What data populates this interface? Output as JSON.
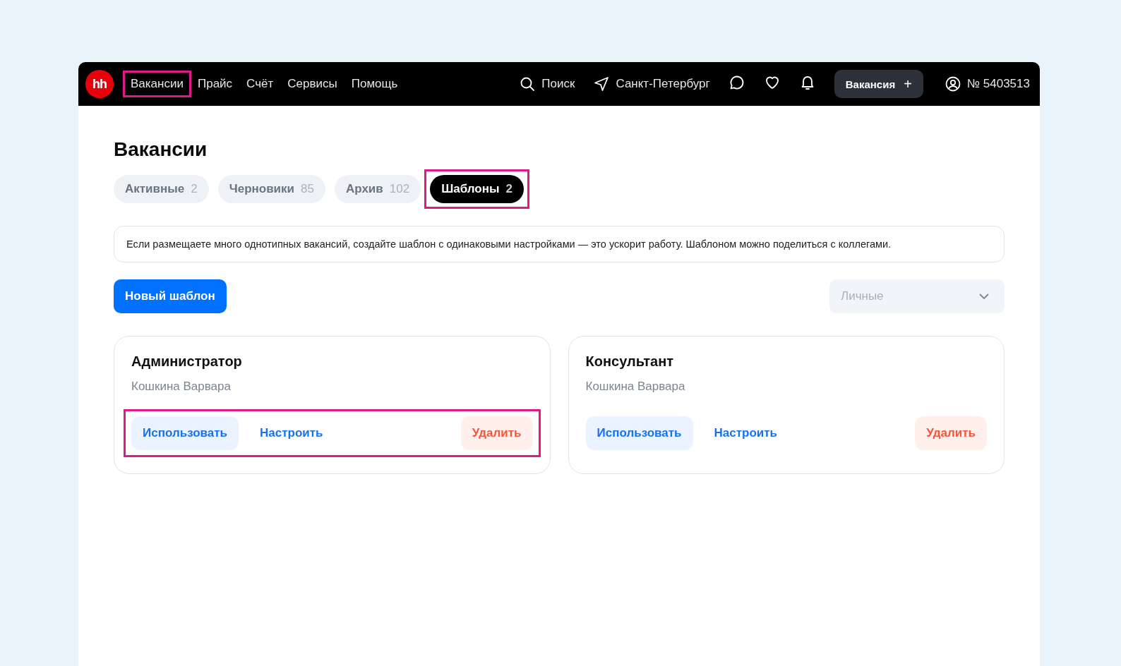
{
  "header": {
    "logo": "hh",
    "nav": [
      {
        "label": "Вакансии",
        "highlighted": true
      },
      {
        "label": "Прайс",
        "highlighted": false
      },
      {
        "label": "Счёт",
        "highlighted": false
      },
      {
        "label": "Сервисы",
        "highlighted": false
      },
      {
        "label": "Помощь",
        "highlighted": false
      }
    ],
    "search": "Поиск",
    "city": "Санкт-Петербург",
    "create_button": "Вакансия",
    "create_plus": "+",
    "account": "№ 5403513"
  },
  "page_title": "Вакансии",
  "tabs": [
    {
      "label": "Активные",
      "count": "2",
      "selected": false,
      "highlighted": false
    },
    {
      "label": "Черновики",
      "count": "85",
      "selected": false,
      "highlighted": false
    },
    {
      "label": "Архив",
      "count": "102",
      "selected": false,
      "highlighted": false
    },
    {
      "label": "Шаблоны",
      "count": "2",
      "selected": true,
      "highlighted": true
    }
  ],
  "info": "Если размещаете много однотипных вакансий, создайте шаблон с одинаковыми настройками — это ускорит работу. Шаблоном можно поделиться с коллегами.",
  "new_button": "Новый шаблон",
  "filter": {
    "placeholder": "Личные"
  },
  "templates": [
    {
      "title": "Администратор",
      "author": "Кошкина Варвара",
      "use": "Использовать",
      "edit": "Настроить",
      "delete": "Удалить",
      "highlighted": true
    },
    {
      "title": "Консультант",
      "author": "Кошкина Варвара",
      "use": "Использовать",
      "edit": "Настроить",
      "delete": "Удалить",
      "highlighted": false
    }
  ]
}
